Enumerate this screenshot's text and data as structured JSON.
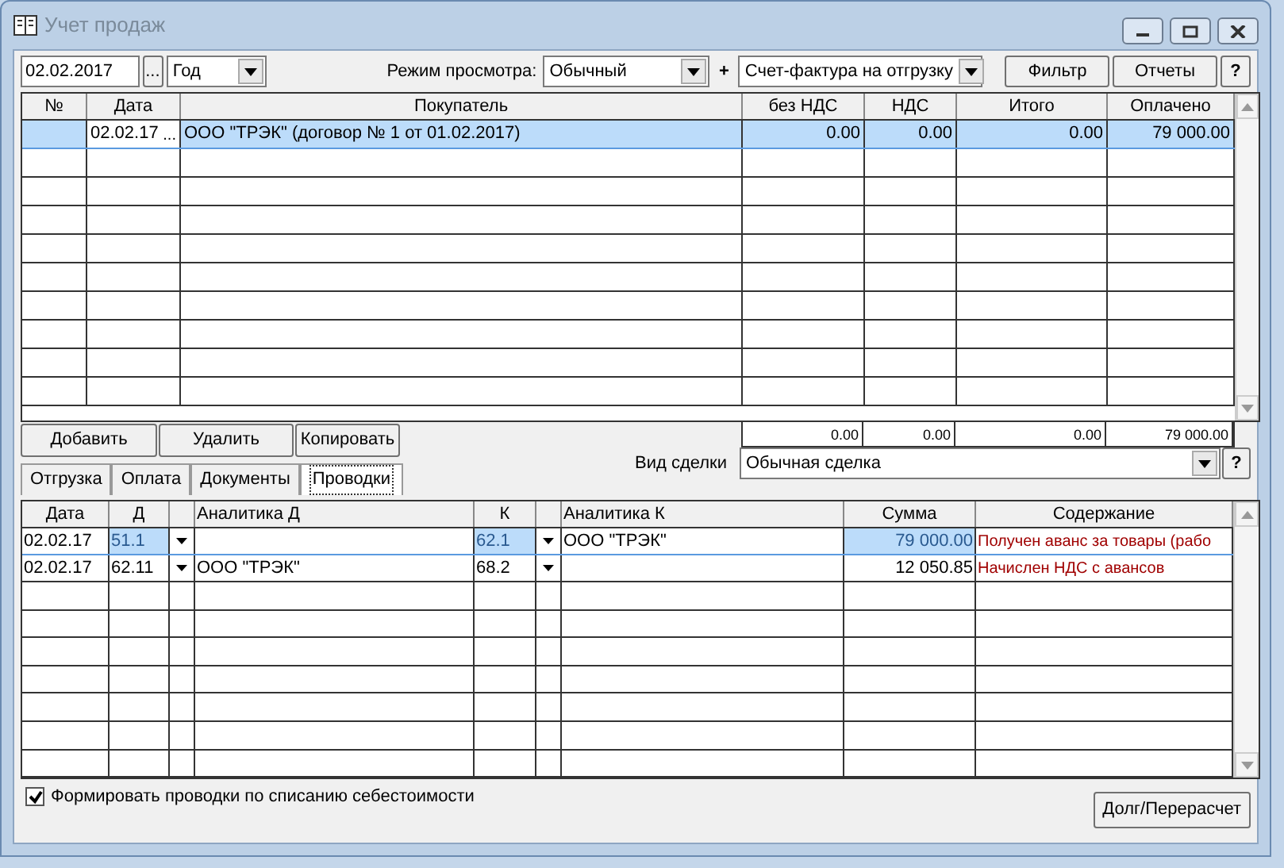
{
  "window": {
    "title": "Учет продаж"
  },
  "toolbar": {
    "date": "02.02.2017",
    "date_button": "...",
    "period": "Год",
    "mode_label": "Режим просмотра:",
    "mode": "Обычный",
    "plus": "+",
    "doc_type": "Счет-фактура на отгрузку",
    "buttons": [
      "Фильтр",
      "Отчеты"
    ],
    "help": "?"
  },
  "sales_table": {
    "columns": [
      "№",
      "Дата",
      "Покупатель",
      "без НДС",
      "НДС",
      "Итого",
      "Оплачено"
    ],
    "rows": [
      {
        "cells": [
          "",
          "02.02.17",
          "ООО \"ТРЭК\" (договор № 1 от 01.02.2017)",
          "0.00",
          "0.00",
          "0.00",
          "79 000.00"
        ],
        "date_button": "...",
        "selected": true
      }
    ],
    "totals": [
      "0.00",
      "0.00",
      "0.00",
      "79 000.00"
    ]
  },
  "actions": [
    "Добавить",
    "Удалить",
    "Копировать"
  ],
  "deal": {
    "label": "Вид сделки",
    "value": "Обычная сделка",
    "help": "?"
  },
  "tabs": [
    {
      "label": "Отгрузка",
      "selected": false
    },
    {
      "label": "Оплата",
      "selected": false
    },
    {
      "label": "Документы",
      "selected": false
    },
    {
      "label": "Проводки",
      "selected": true
    }
  ],
  "entries_table": {
    "columns": [
      "Дата",
      "Д",
      "",
      "Аналитика Д",
      "К",
      "",
      "Аналитика К",
      "Сумма",
      "Содержание"
    ],
    "rows": [
      {
        "date": "02.02.17",
        "debit": "51.1",
        "debit_analytics": "",
        "credit": "62.1",
        "credit_analytics": "ООО \"ТРЭК\"",
        "sum": "79 000.00",
        "content": "Получен аванс за товары (рабо",
        "selected": true
      },
      {
        "date": "02.02.17",
        "debit": "62.11",
        "debit_analytics": "ООО \"ТРЭК\"",
        "credit": "68.2",
        "credit_analytics": "",
        "sum": "12 050.85",
        "content": "Начислен НДС с авансов",
        "selected": false
      }
    ]
  },
  "cost_entries": {
    "label": "Формировать проводки по списанию себестоимости",
    "checked": true
  },
  "debt_button": "Долг/Перерасчет"
}
